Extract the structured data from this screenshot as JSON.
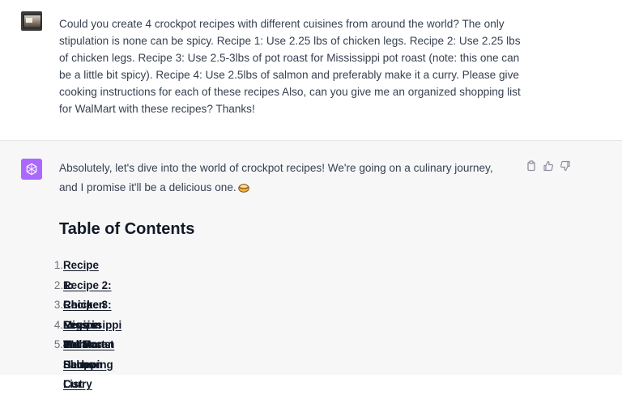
{
  "user_message": {
    "text": "Could you create 4 crockpot recipes with different cuisines from around the world? The only stipulation is none can be spicy. Recipe 1: Use 2.25 lbs of chicken legs. Recipe 2: Use 2.25 lbs of chicken legs. Recipe 3: Use 2.5-3lbs of pot roast for Mississippi pot roast (note: this one can be a little bit spicy). Recipe 4: Use 2.5lbs of salmon and preferably make it a curry. Please give cooking instructions for each of these recipes Also, can you give me an organized shopping list for WalMart with these recipes? Thanks!",
    "avatar_icon": "user-avatar-image"
  },
  "assistant_message": {
    "avatar_icon": "openai-logo-icon",
    "avatar_color": "#ab68ff",
    "intro": "Absolutely, let's dive into the world of crockpot recipes! We're going on a culinary journey, and I promise it'll be a delicious one.",
    "emoji_icon": "steaming-bowl-emoji",
    "actions": [
      {
        "name": "copy-icon"
      },
      {
        "name": "thumbs-up-icon"
      },
      {
        "name": "thumbs-down-icon"
      }
    ],
    "toc_heading": "Table of Contents",
    "toc_items": [
      {
        "num": "1.",
        "label": "Recipe 1: Chicken Legs in Italian Herbs"
      },
      {
        "num": "2.",
        "label": "Recipe 2: Chicken Legs in Moroccan Sauce"
      },
      {
        "num": "3.",
        "label": "Recipe 3: Mississippi Pot Roast"
      },
      {
        "num": "4.",
        "label": "Recipe 4: Salmon Curry"
      },
      {
        "num": "5.",
        "label": "WalMart Shopping List"
      }
    ]
  }
}
